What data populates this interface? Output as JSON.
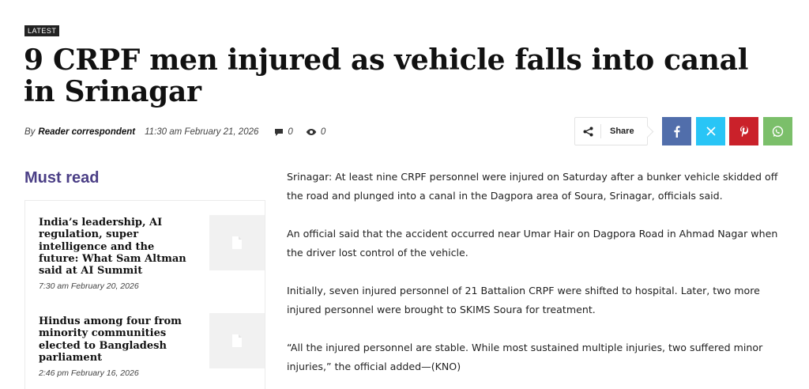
{
  "badge": "LATEST",
  "headline": "9  CRPF men injured as vehicle falls into canal in Srinagar",
  "meta": {
    "by": "By",
    "author": "Reader correspondent",
    "datetime": "11:30 am February 21, 2026",
    "comments": "0",
    "views": "0"
  },
  "share": {
    "label": "Share",
    "buttons": [
      "facebook-icon",
      "x-twitter-icon",
      "pinterest-icon",
      "whatsapp-icon"
    ],
    "colors": {
      "facebook": "#516eab",
      "twitter": "#29c5f6",
      "pinterest": "#ca212a",
      "whatsapp": "#7bbf6a"
    }
  },
  "must_read": {
    "heading": "Must read",
    "heading_color": "#4b3f86",
    "items": [
      {
        "title": "India’s leadership, AI regulation, super intelligence and the future: What Sam Altman said at AI Summit",
        "date": "7:30 am February 20, 2026"
      },
      {
        "title": "Hindus among four from minority communities elected to Bangladesh parliament",
        "date": "2:46 pm February 16, 2026"
      }
    ]
  },
  "article": {
    "paragraphs": [
      "Srinagar: At least nine CRPF personnel were injured on Saturday after a bunker vehicle skidded off the road and plunged into a canal in the Dagpora area of Soura, Srinagar, officials said.",
      "An official said that the accident occurred near Umar Hair on Dagpora Road in Ahmad Nagar when the driver lost control of the vehicle.",
      "Initially, seven injured personnel of 21 Battalion CRPF were shifted to hospital. Later, two more injured personnel were brought to SKIMS Soura for treatment.",
      "“All the injured personnel are stable. While most sustained multiple injuries, two suffered minor injuries,” the official added—(KNO)"
    ]
  }
}
